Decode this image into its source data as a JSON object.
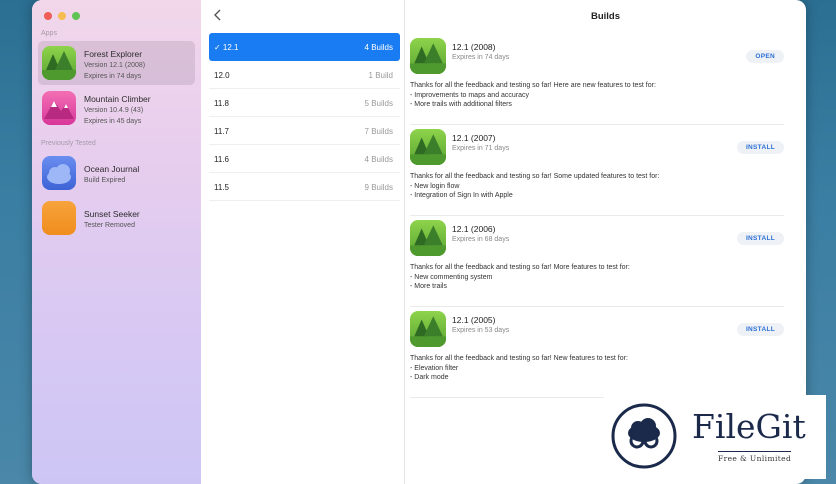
{
  "sidebar": {
    "apps_label": "Apps",
    "previously_tested_label": "Previously Tested",
    "apps": [
      {
        "name": "Forest Explorer",
        "line1": "Version 12.1 (2008)",
        "line2": "Expires in 74 days",
        "icon": "forest-icon"
      },
      {
        "name": "Mountain Climber",
        "line1": "Version 10.4.9 (43)",
        "line2": "Expires in 45 days",
        "icon": "mountain-icon"
      }
    ],
    "previous": [
      {
        "name": "Ocean Journal",
        "line1": "Build Expired",
        "icon": "cloud-icon"
      },
      {
        "name": "Sunset Seeker",
        "line1": "Tester Removed",
        "icon": "sunset-icon"
      }
    ]
  },
  "header": {
    "title": "Builds",
    "back_icon": "chevron-left-icon"
  },
  "builds": [
    {
      "version": "✓ 12.1",
      "count": "4 Builds"
    },
    {
      "version": "12.0",
      "count": "1 Build"
    },
    {
      "version": "11.8",
      "count": "5 Builds"
    },
    {
      "version": "11.7",
      "count": "7 Builds"
    },
    {
      "version": "11.6",
      "count": "4 Builds"
    },
    {
      "version": "11.5",
      "count": "9 Builds"
    }
  ],
  "details": [
    {
      "title": "12.1 (2008)",
      "expires": "Expires in 74 days",
      "button": "OPEN",
      "notes": [
        "Thanks for all the feedback and testing so far! Here are new features to test for:",
        "- Improvements to maps and accuracy",
        "- More trails with additional filters"
      ]
    },
    {
      "title": "12.1 (2007)",
      "expires": "Expires in 71 days",
      "button": "INSTALL",
      "notes": [
        "Thanks for all the feedback and testing so far! Some updated features to test for:",
        "- New login flow",
        "- Integration of Sign In with Apple"
      ]
    },
    {
      "title": "12.1 (2006)",
      "expires": "Expires in 68 days",
      "button": "INSTALL",
      "notes": [
        "Thanks for all the feedback and testing so far! More features to test for:",
        "- New commenting system",
        "- More trails"
      ]
    },
    {
      "title": "12.1 (2005)",
      "expires": "Expires in 53 days",
      "button": "INSTALL",
      "notes": [
        "Thanks for all the feedback and testing so far! New features to test for:",
        "- Elevation filter",
        "- Dark mode"
      ]
    }
  ],
  "watermark": {
    "name": "FileGit",
    "tagline": "Free & Unlimited"
  },
  "colors": {
    "accent": "#1a7cf2",
    "button_text": "#2a6fd6"
  }
}
